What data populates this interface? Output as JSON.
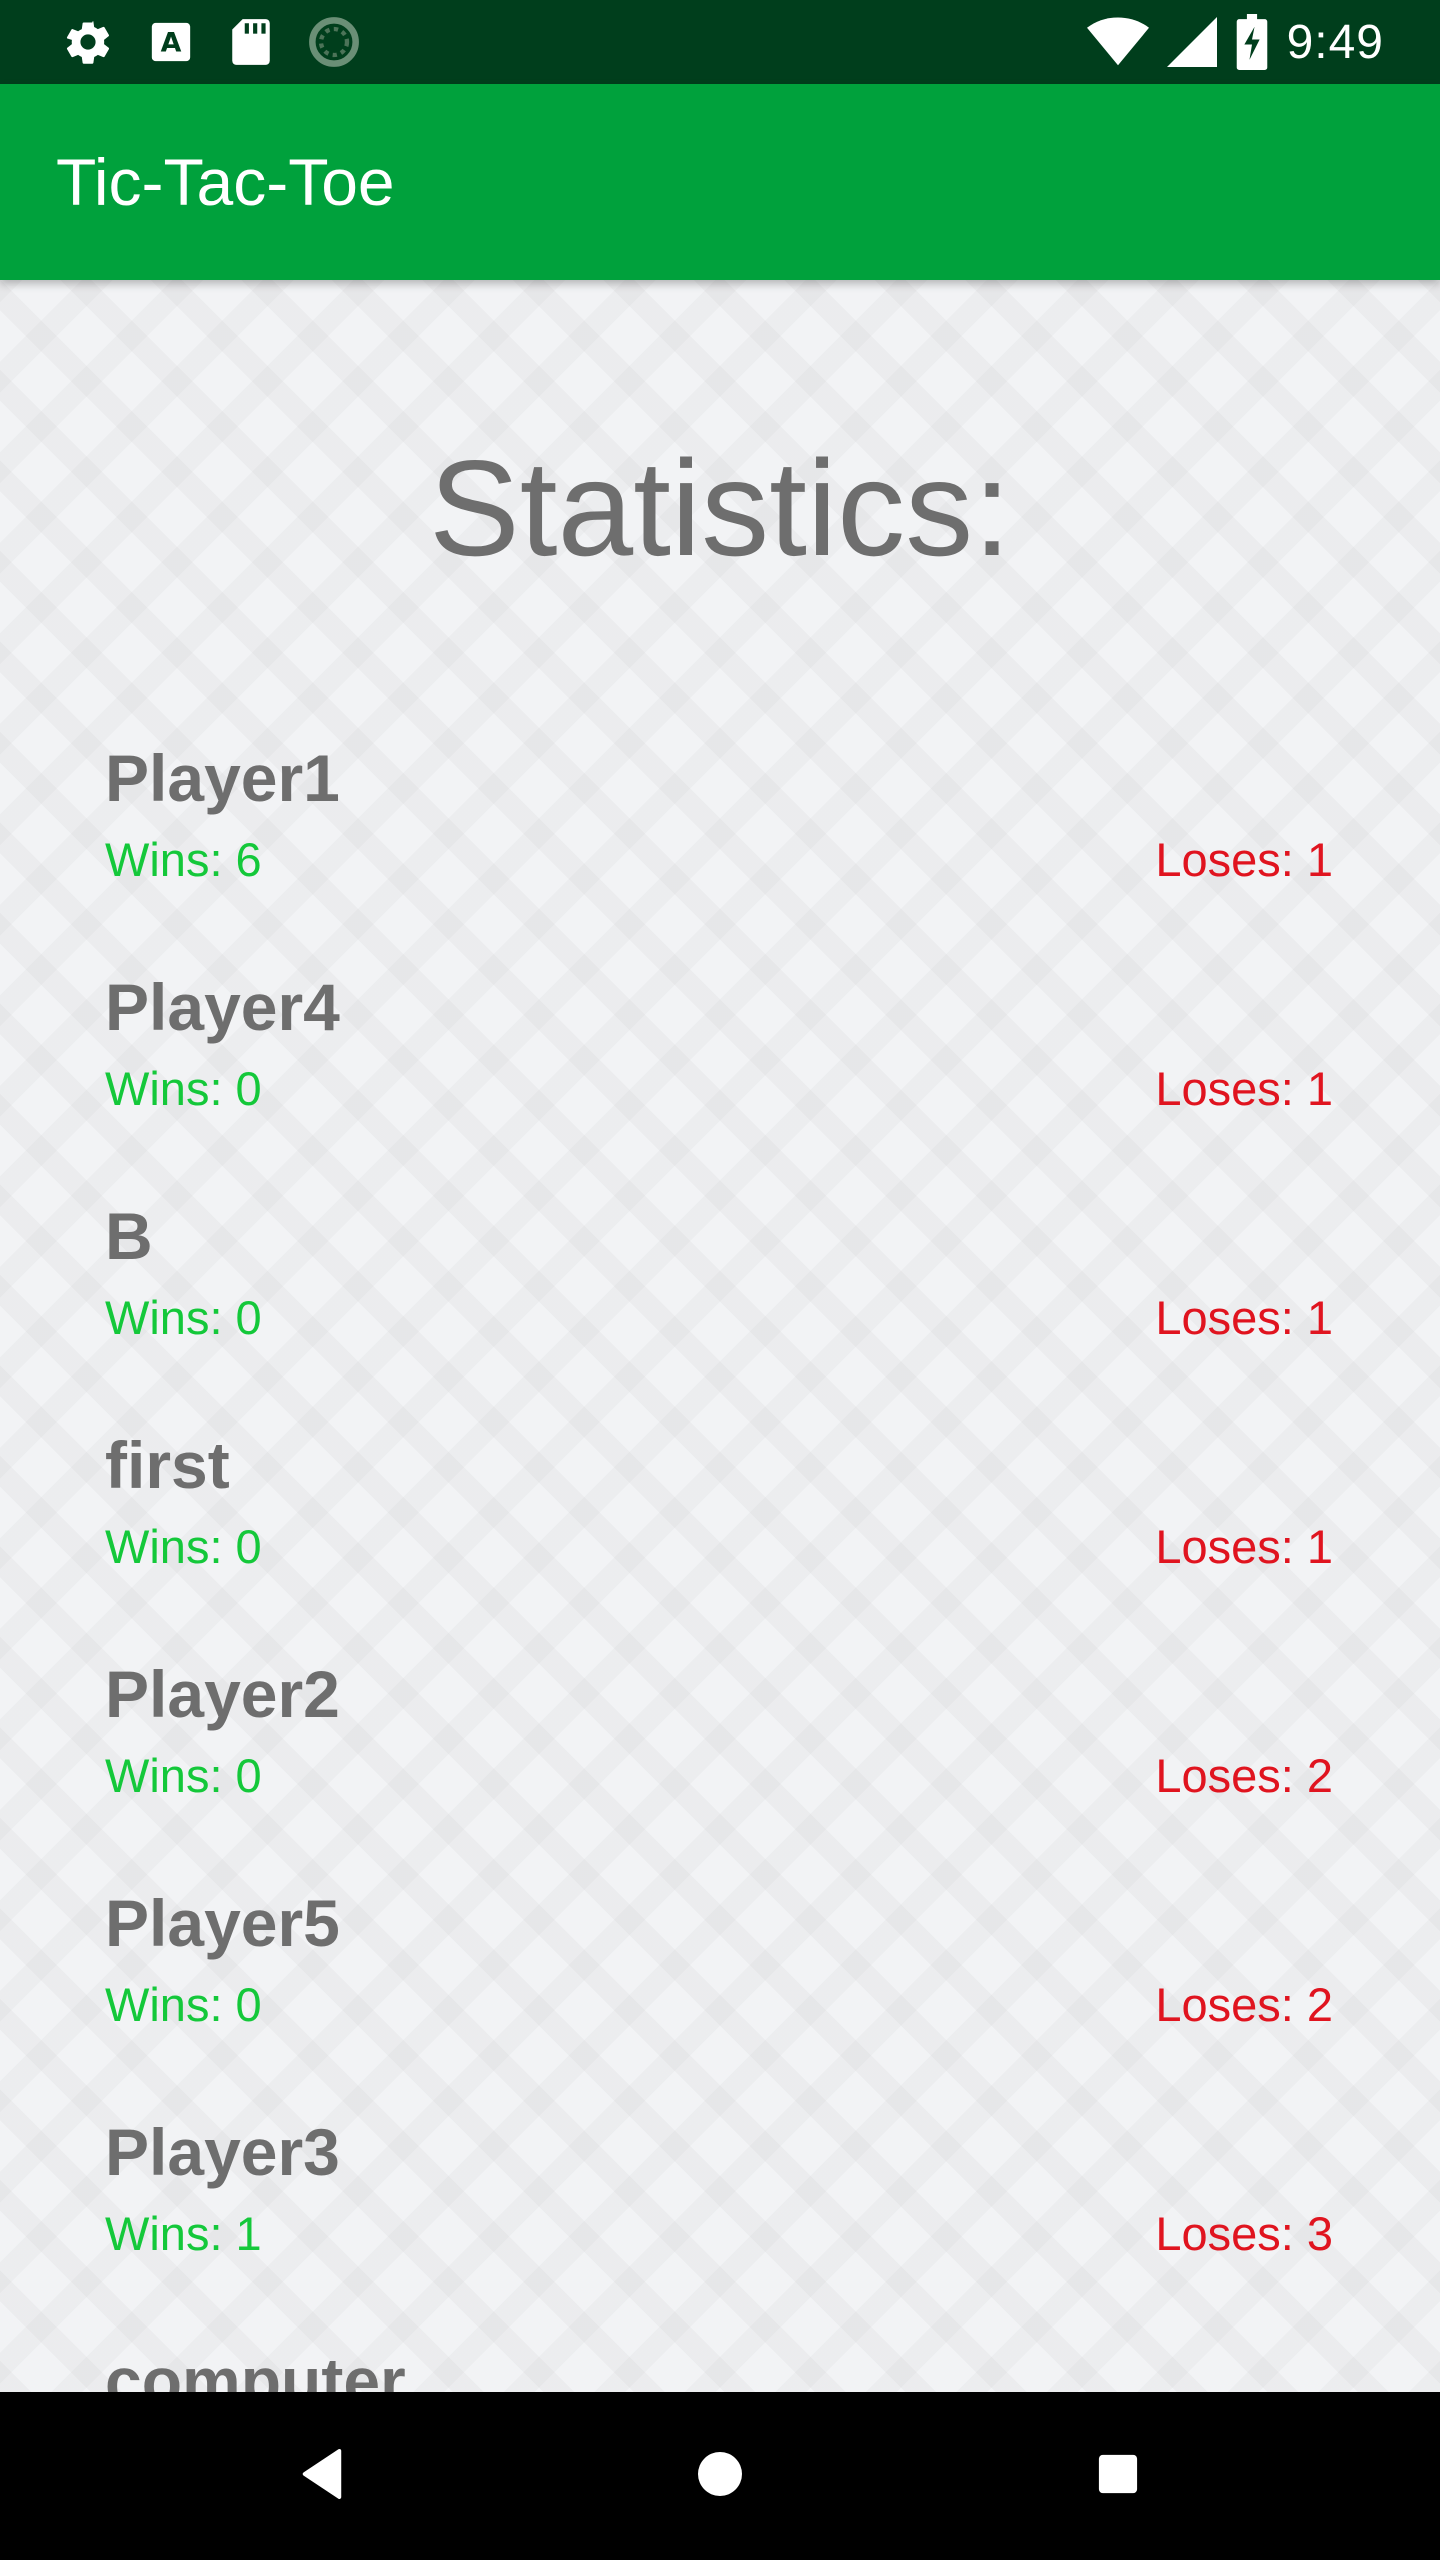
{
  "status_bar": {
    "time": "9:49",
    "left_icons": [
      "settings-icon",
      "a-box-icon",
      "sd-card-icon",
      "loading-icon"
    ],
    "right_icons": [
      "wifi-icon",
      "signal-icon",
      "battery-charging-icon"
    ]
  },
  "app_bar": {
    "title": "Tic-Tac-Toe"
  },
  "page": {
    "title": "Statistics:"
  },
  "stats": [
    {
      "name": "Player1",
      "wins": "Wins: 6",
      "loses": "Loses: 1"
    },
    {
      "name": "Player4",
      "wins": "Wins: 0",
      "loses": "Loses: 1"
    },
    {
      "name": "B",
      "wins": "Wins: 0",
      "loses": "Loses: 1"
    },
    {
      "name": "first",
      "wins": "Wins: 0",
      "loses": "Loses: 1"
    },
    {
      "name": "Player2",
      "wins": "Wins: 0",
      "loses": "Loses: 2"
    },
    {
      "name": "Player5",
      "wins": "Wins: 0",
      "loses": "Loses: 2"
    },
    {
      "name": "Player3",
      "wins": "Wins: 1",
      "loses": "Loses: 3"
    },
    {
      "name": "computer",
      "wins": "",
      "loses": ""
    }
  ],
  "nav_bar": {
    "buttons": [
      "back-icon",
      "home-icon",
      "recents-icon"
    ]
  },
  "colors": {
    "status_bar": "#003e1c",
    "app_bar": "#00a13c",
    "wins": "#14c83a",
    "loses": "#e0141f",
    "text_gray": "#6e6e6e"
  }
}
